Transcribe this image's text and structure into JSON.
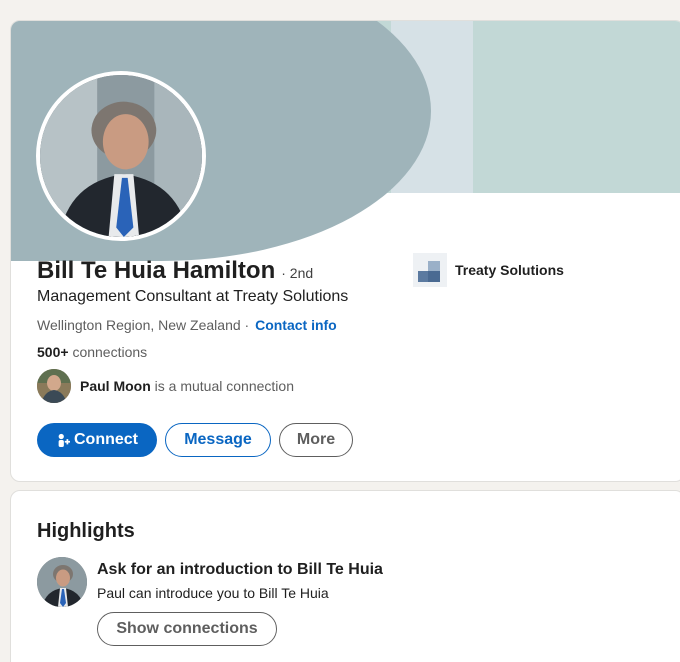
{
  "profile": {
    "name": "Bill Te Huia Hamilton",
    "degree": "· 2nd",
    "headline": "Management Consultant at Treaty Solutions",
    "location": "Wellington Region, New Zealand ·",
    "contact_info_label": "Contact info",
    "connections_count": "500+",
    "connections_label": "connections",
    "mutual": {
      "name": "Paul Moon",
      "text": "is a mutual connection"
    },
    "company": "Treaty Solutions",
    "actions": {
      "connect_label": "Connect",
      "message_label": "Message",
      "more_label": "More"
    }
  },
  "highlights": {
    "title": "Highlights",
    "intro_heading": "Ask for an introduction to Bill Te Huia",
    "intro_sub": "Paul can introduce you to Bill Te Huia",
    "show_connections_label": "Show connections"
  },
  "icons": {
    "connect": "add-person-icon",
    "company_logo": "treaty-solutions-logo-icon"
  },
  "colors": {
    "brand_blue": "#0a66c2",
    "banner_dark": "#9fb4ba",
    "banner_light": "#c2d8d6",
    "page_bg": "#f4f2ee"
  }
}
